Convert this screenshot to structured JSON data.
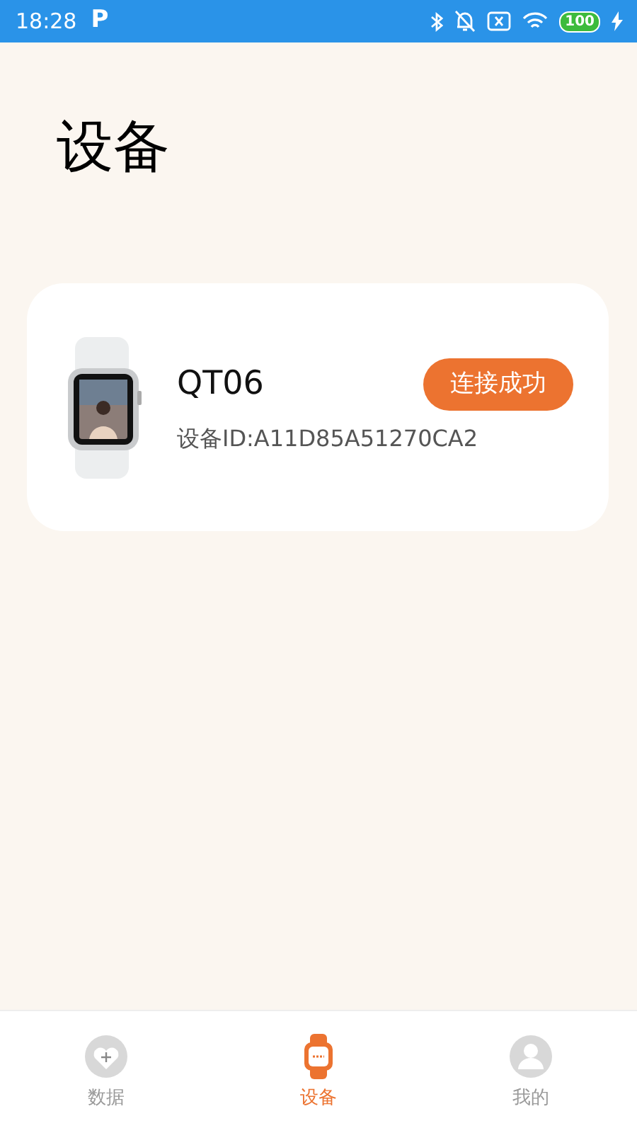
{
  "status_bar": {
    "time": "18:28",
    "app_badge": "P",
    "battery": "100",
    "charging": true
  },
  "page": {
    "title": "设备"
  },
  "devices": [
    {
      "name": "QT06",
      "id_label": "设备ID:",
      "id": "A11D85A51270CA2",
      "status": "连接成功",
      "connected": true
    }
  ],
  "tab_bar": [
    {
      "label": "数据",
      "kind": "data",
      "selected": false
    },
    {
      "label": "设备",
      "kind": "device",
      "selected": true
    },
    {
      "label": "我的",
      "kind": "profile",
      "selected": false
    }
  ]
}
